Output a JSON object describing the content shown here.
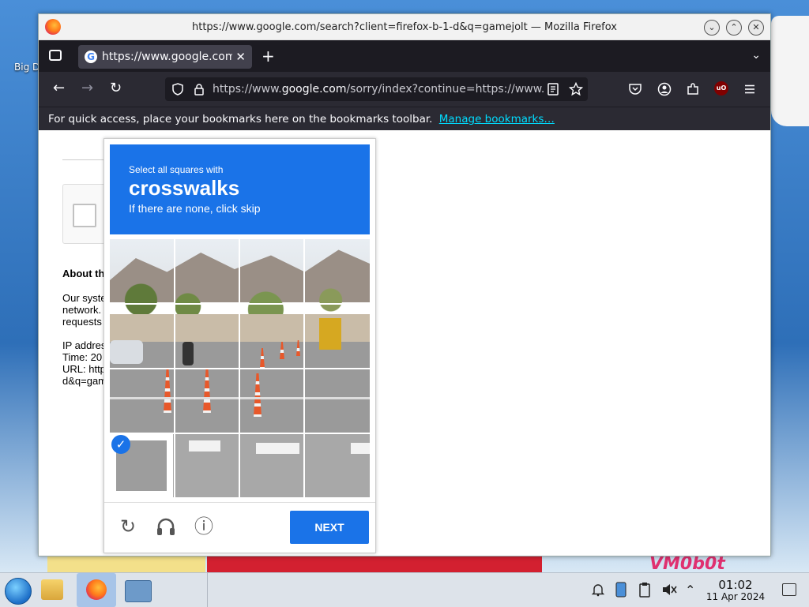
{
  "window": {
    "title": "https://www.google.com/search?client=firefox-b-1-d&q=gamejolt — Mozilla Firefox",
    "minimize_glyph": "⌄",
    "maximize_glyph": "⌃",
    "close_glyph": "✕"
  },
  "desktop": {
    "icon_label": "Big D",
    "watermark": "VM0b0t"
  },
  "tabs": [
    {
      "label": "https://www.google.com/",
      "favicon": "G",
      "close": "✕"
    }
  ],
  "tabbar": {
    "new_tab": "+",
    "list_all": "⌄"
  },
  "navbar": {
    "back": "←",
    "forward": "→",
    "reload": "↻",
    "url_prefix": "https://www.",
    "url_host": "google.com",
    "url_rest": "/sorry/index?continue=https://www.google.com/search",
    "ublock_label": "uO"
  },
  "bookmarks_bar": {
    "text": "For quick access, place your bookmarks here on the bookmarks toolbar.",
    "link": "Manage bookmarks…"
  },
  "page": {
    "about": "About th",
    "line1": "Our syste",
    "line2": "network.",
    "line3": "requests",
    "ip": "IP addres",
    "time": "Time: 20",
    "url1": "URL: http",
    "url2": "d&q=gam"
  },
  "captcha": {
    "instruction": "Select all squares with",
    "object": "crosswalks",
    "hint": "If there are none, click skip",
    "next_label": "NEXT",
    "selected_check": "✓",
    "reload_icon": "↻",
    "audio_icon": "🎧",
    "info_icon": "ⓘ"
  },
  "taskbar": {
    "time": "01:02",
    "date": "11 Apr 2024",
    "tray_up": "⌃"
  },
  "colors": {
    "captcha_blue": "#1a73e8",
    "firefox_dark": "#2b2a33",
    "link_cyan": "#00ddff"
  }
}
